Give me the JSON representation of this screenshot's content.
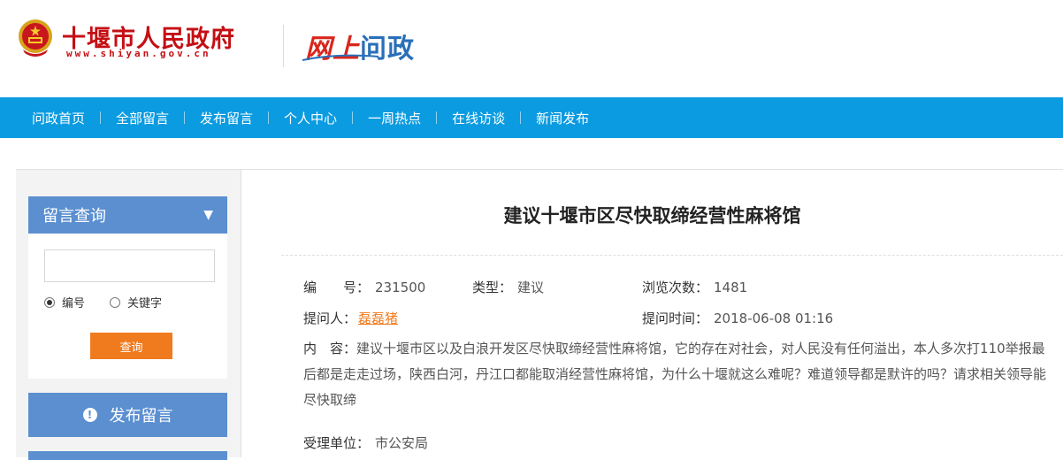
{
  "header": {
    "gov_name": "十堰市人民政府",
    "gov_url": "www.shiyan.gov.cn",
    "brand_part1": "网上",
    "brand_part2": "问政"
  },
  "nav": {
    "items": [
      "问政首页",
      "全部留言",
      "发布留言",
      "个人中心",
      "一周热点",
      "在线访谈",
      "新闻发布"
    ]
  },
  "sidebar": {
    "panel_title": "留言查询",
    "search_value": "",
    "radio_number": "编号",
    "radio_keyword": "关键字",
    "selected": "编号",
    "query_button": "查询",
    "post_button": "发布留言"
  },
  "article": {
    "title": "建议十堰市区尽快取缔经营性麻将馆",
    "number_label": "编　　号：",
    "number": "231500",
    "type_label": "类型：",
    "type": "建议",
    "views_label": "浏览次数：",
    "views": "1481",
    "asker_label": "提问人：",
    "asker": "磊磊猪",
    "time_label": "提问时间：",
    "time": "2018-06-08 01:16",
    "content_label": "内　容：",
    "content": "建议十堰市区以及白浪开发区尽快取缔经营性麻将馆，它的存在对社会，对人民没有任何溢出，本人多次打110举报最后都是走走过场，陕西白河，丹江口都能取消经营性麻将馆，为什么十堰就这么难呢？难道领导都是默许的吗？请求相关领导能尽快取缔",
    "dept_label": "受理单位：",
    "dept": "市公安局"
  },
  "colors": {
    "nav_bg": "#0b9be0",
    "panel_blue": "#5b8fd0",
    "query_orange": "#f07b1f",
    "gov_red": "#c40f14"
  }
}
